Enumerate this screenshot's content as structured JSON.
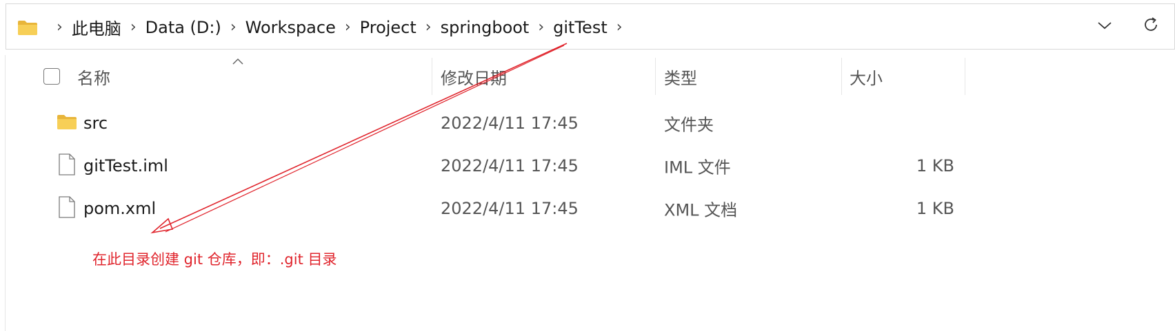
{
  "address_bar": {
    "breadcrumbs": [
      "此电脑",
      "Data (D:)",
      "Workspace",
      "Project",
      "springboot",
      "gitTest"
    ],
    "separator": "›",
    "folder_icon": "folder-icon",
    "dropdown_icon": "chevron-down-icon",
    "refresh_icon": "refresh-icon"
  },
  "columns": {
    "name": "名称",
    "modified": "修改日期",
    "type": "类型",
    "size": "大小"
  },
  "files": [
    {
      "name": "src",
      "modified": "2022/4/11 17:45",
      "type": "文件夹",
      "size": "",
      "icon": "folder-icon"
    },
    {
      "name": "gitTest.iml",
      "modified": "2022/4/11 17:45",
      "type": "IML 文件",
      "size": "1 KB",
      "icon": "file-icon"
    },
    {
      "name": "pom.xml",
      "modified": "2022/4/11 17:45",
      "type": "XML 文档",
      "size": "1 KB",
      "icon": "file-icon"
    }
  ],
  "annotation": {
    "text": "在此目录创建 git 仓库，即：.git 目录",
    "color": "#e0242c"
  }
}
